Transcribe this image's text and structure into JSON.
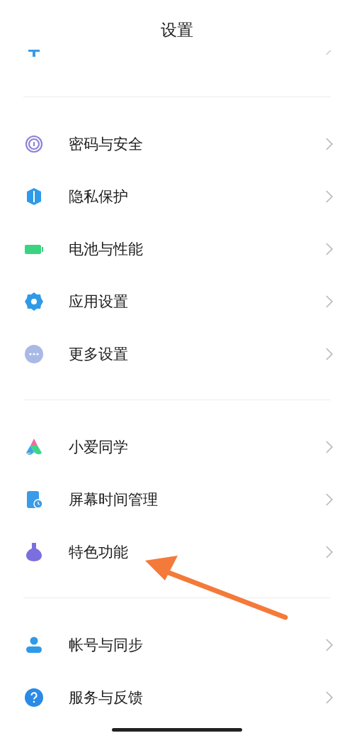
{
  "title": "设置",
  "partial_row": {
    "kind": "theme"
  },
  "groups": [
    {
      "items": [
        {
          "kind": "fingerprint",
          "label": "密码与安全"
        },
        {
          "kind": "shield",
          "label": "隐私保护"
        },
        {
          "kind": "battery",
          "label": "电池与性能"
        },
        {
          "kind": "gear",
          "label": "应用设置"
        },
        {
          "kind": "more",
          "label": "更多设置"
        }
      ]
    },
    {
      "items": [
        {
          "kind": "assistant",
          "label": "小爱同学"
        },
        {
          "kind": "screentime",
          "label": "屏幕时间管理"
        },
        {
          "kind": "flask",
          "label": "特色功能"
        }
      ]
    },
    {
      "items": [
        {
          "kind": "person",
          "label": "帐号与同步"
        },
        {
          "kind": "help",
          "label": "服务与反馈"
        }
      ]
    }
  ],
  "annotation": {
    "kind": "arrow"
  }
}
